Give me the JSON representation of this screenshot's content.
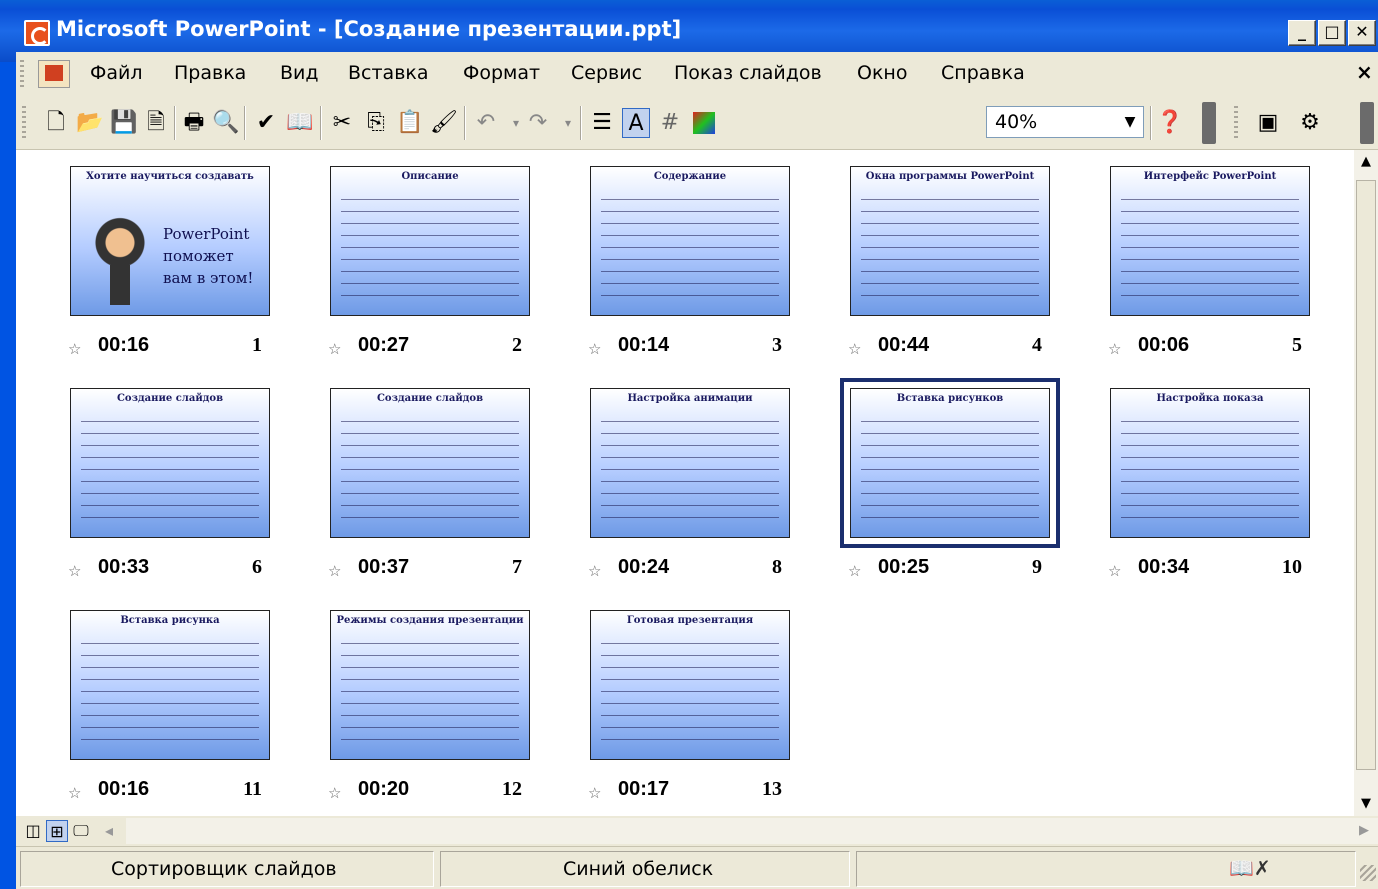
{
  "window": {
    "title": "Microsoft PowerPoint - [Создание презентации.ppt]",
    "minimize": "_",
    "maximize": "□",
    "close": "✕"
  },
  "menu": {
    "items": [
      "Файл",
      "Правка",
      "Вид",
      "Вставка",
      "Формат",
      "Сервис",
      "Показ слайдов",
      "Окно",
      "Справка"
    ],
    "close": "×"
  },
  "toolbar": {
    "zoom": "40%"
  },
  "slides": [
    {
      "time": "00:16",
      "number": "1",
      "title": "Хотите научиться создавать",
      "caption": "PowerPoint поможет вам в этом!"
    },
    {
      "time": "00:27",
      "number": "2",
      "title": "Описание"
    },
    {
      "time": "00:14",
      "number": "3",
      "title": "Содержание"
    },
    {
      "time": "00:44",
      "number": "4",
      "title": "Окна программы PowerPoint"
    },
    {
      "time": "00:06",
      "number": "5",
      "title": "Интерфейс PowerPoint"
    },
    {
      "time": "00:33",
      "number": "6",
      "title": "Создание слайдов"
    },
    {
      "time": "00:37",
      "number": "7",
      "title": "Создание слайдов"
    },
    {
      "time": "00:24",
      "number": "8",
      "title": "Настройка анимации"
    },
    {
      "time": "00:25",
      "number": "9",
      "title": "Вставка рисунков"
    },
    {
      "time": "00:34",
      "number": "10",
      "title": "Настройка показа"
    },
    {
      "time": "00:16",
      "number": "11",
      "title": "Вставка рисунка"
    },
    {
      "time": "00:20",
      "number": "12",
      "title": "Режимы создания презентации"
    },
    {
      "time": "00:17",
      "number": "13",
      "title": "Готовая презентация"
    }
  ],
  "selected_slide": "9",
  "status": {
    "view": "Сортировщик слайдов",
    "design": "Синий обелиск"
  }
}
